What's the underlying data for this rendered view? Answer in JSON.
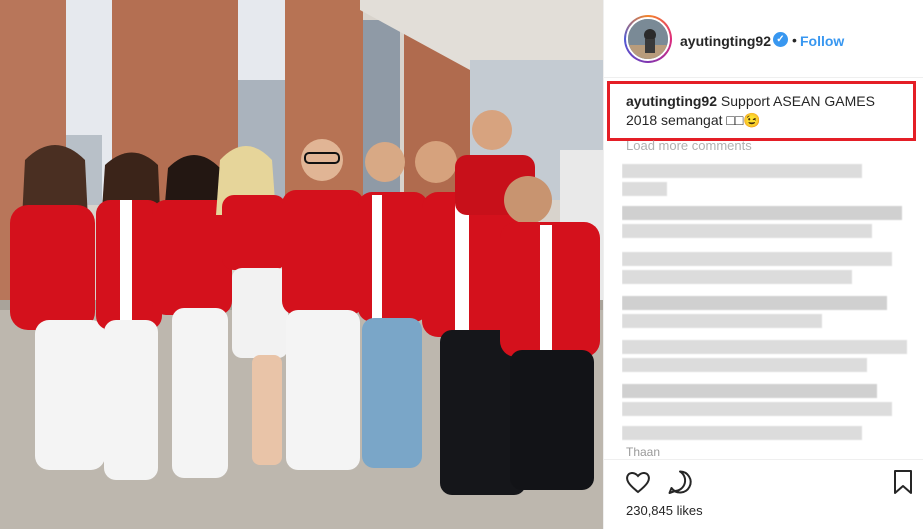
{
  "post": {
    "username": "ayutingting92",
    "verified_symbol": "✓",
    "separator": "•",
    "follow_label": "Follow",
    "caption_user": "ayutingting92",
    "caption_text": " Support ASEAN GAMES 2018 semangat □□😉",
    "load_more_label": "Load more comments",
    "comments_tail": "Thaan",
    "likes": "230,845 likes"
  },
  "colors": {
    "accent": "#3897f0",
    "highlight_border": "#e41e26",
    "shirt_red": "#d4111c"
  },
  "icons": {
    "like": "heart-icon",
    "comment": "comment-icon",
    "save": "bookmark-icon",
    "verified": "verified-badge-icon"
  }
}
